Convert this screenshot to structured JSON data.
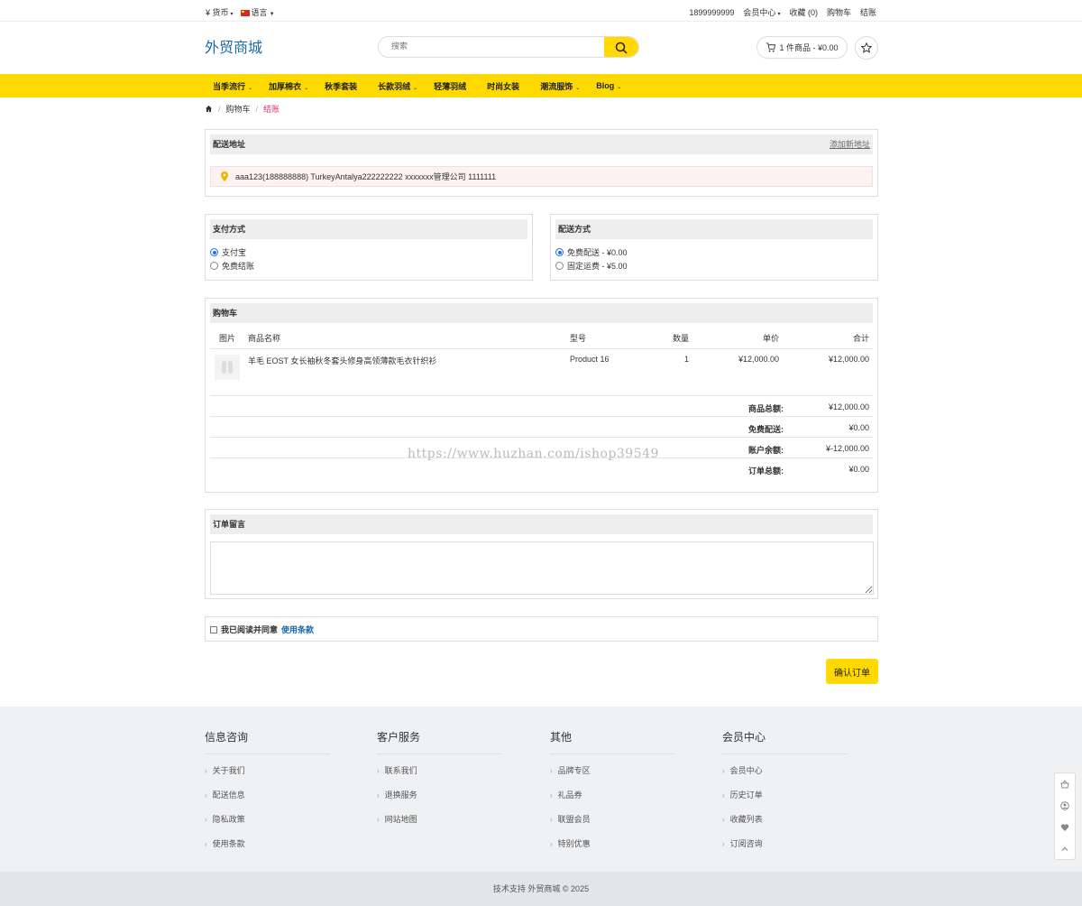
{
  "topbar": {
    "currency": "货币",
    "language": "语言",
    "phone": "1899999999",
    "member": "会员中心",
    "favorites": "收藏 (0)",
    "cart": "购物车",
    "checkout": "结账"
  },
  "header": {
    "logo": "外贸商城",
    "search_placeholder": "搜索",
    "cart_text": "1 件商品 - ¥0.00"
  },
  "nav": [
    "当季流行",
    "加厚棉衣",
    "秋季套装",
    "长款羽绒",
    "轻薄羽绒",
    "时尚女装",
    "潮流服饰",
    "Blog"
  ],
  "breadcrumb": {
    "cart": "购物车",
    "current": "结账"
  },
  "address": {
    "title": "配送地址",
    "add_link": "添加新地址",
    "line": "aaa123(188888888) TurkeyAntalya222222222 xxxxxxx管理公司 1111111"
  },
  "payment": {
    "title": "支付方式",
    "options": [
      "支付宝",
      "免费结账"
    ]
  },
  "shipping": {
    "title": "配送方式",
    "options": [
      "免费配送 - ¥0.00",
      "固定运费 - ¥5.00"
    ]
  },
  "cart": {
    "title": "购物车",
    "columns": {
      "image": "图片",
      "name": "商品名称",
      "model": "型号",
      "qty": "数量",
      "price": "单价",
      "total": "合计"
    },
    "item": {
      "name": "羊毛 EOST 女长袖秋冬套头修身高领薄款毛衣针织衫",
      "model": "Product 16",
      "qty": "1",
      "price": "¥12,000.00",
      "total": "¥12,000.00"
    },
    "totals": [
      {
        "k": "商品总额:",
        "v": "¥12,000.00"
      },
      {
        "k": "免费配送:",
        "v": "¥0.00"
      },
      {
        "k": "账户余额:",
        "v": "¥-12,000.00"
      },
      {
        "k": "订单总额:",
        "v": "¥0.00"
      }
    ]
  },
  "comment": {
    "title": "订单留言"
  },
  "agree": {
    "text": "我已阅读并同意",
    "link": "使用条款"
  },
  "confirm": "确认订单",
  "watermark": "https://www.huzhan.com/ishop39549",
  "footer": {
    "cols": [
      {
        "title": "信息咨询",
        "items": [
          "关于我们",
          "配送信息",
          "隐私政策",
          "使用条款"
        ]
      },
      {
        "title": "客户服务",
        "items": [
          "联系我们",
          "退换服务",
          "网站地图"
        ]
      },
      {
        "title": "其他",
        "items": [
          "品牌专区",
          "礼品券",
          "联盟会员",
          "特别优惠"
        ]
      },
      {
        "title": "会员中心",
        "items": [
          "会员中心",
          "历史订单",
          "收藏列表",
          "订阅咨询"
        ]
      }
    ],
    "copyright": "技术支持 外贸商城 © 2025"
  },
  "colors": {
    "accent": "#ffd900",
    "logo": "#1b6aa8",
    "link": "#1b6aa8",
    "breadcrumb_active": "#d6336c"
  }
}
